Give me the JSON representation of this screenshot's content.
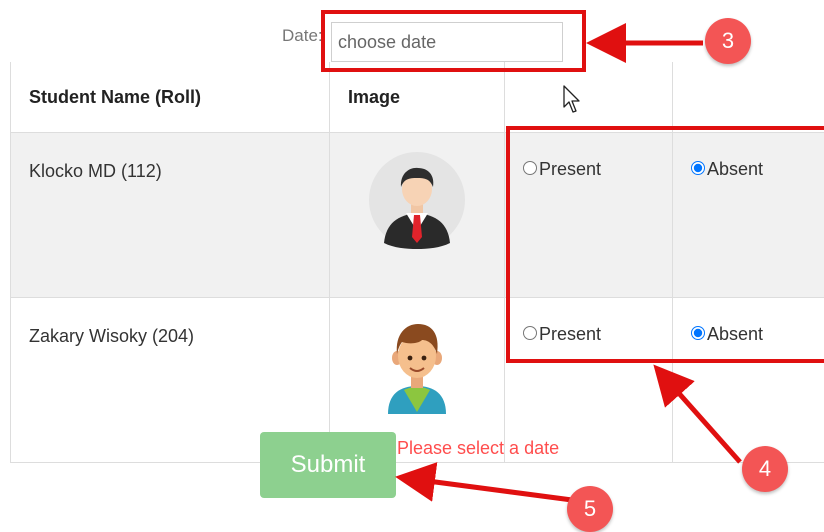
{
  "date": {
    "label": "Date:",
    "placeholder": "choose date"
  },
  "table": {
    "headers": [
      "Student Name (Roll)",
      "Image",
      "",
      ""
    ],
    "rows": [
      {
        "name": "Klocko MD (112)",
        "avatar_icon": "businessman-avatar",
        "present_label": "Present",
        "absent_label": "Absent",
        "selected": "Absent"
      },
      {
        "name": "Zakary Wisoky (204)",
        "avatar_icon": "boy-avatar",
        "present_label": "Present",
        "absent_label": "Absent",
        "selected": "Absent"
      }
    ]
  },
  "submit_label": "Submit",
  "error_message": "Please select a date",
  "annotations": [
    "3",
    "4",
    "5"
  ],
  "colors": {
    "annotation_red": "#e01010",
    "badge": "#f35555",
    "submit": "#8dd08f",
    "error": "#ff4d4d"
  }
}
